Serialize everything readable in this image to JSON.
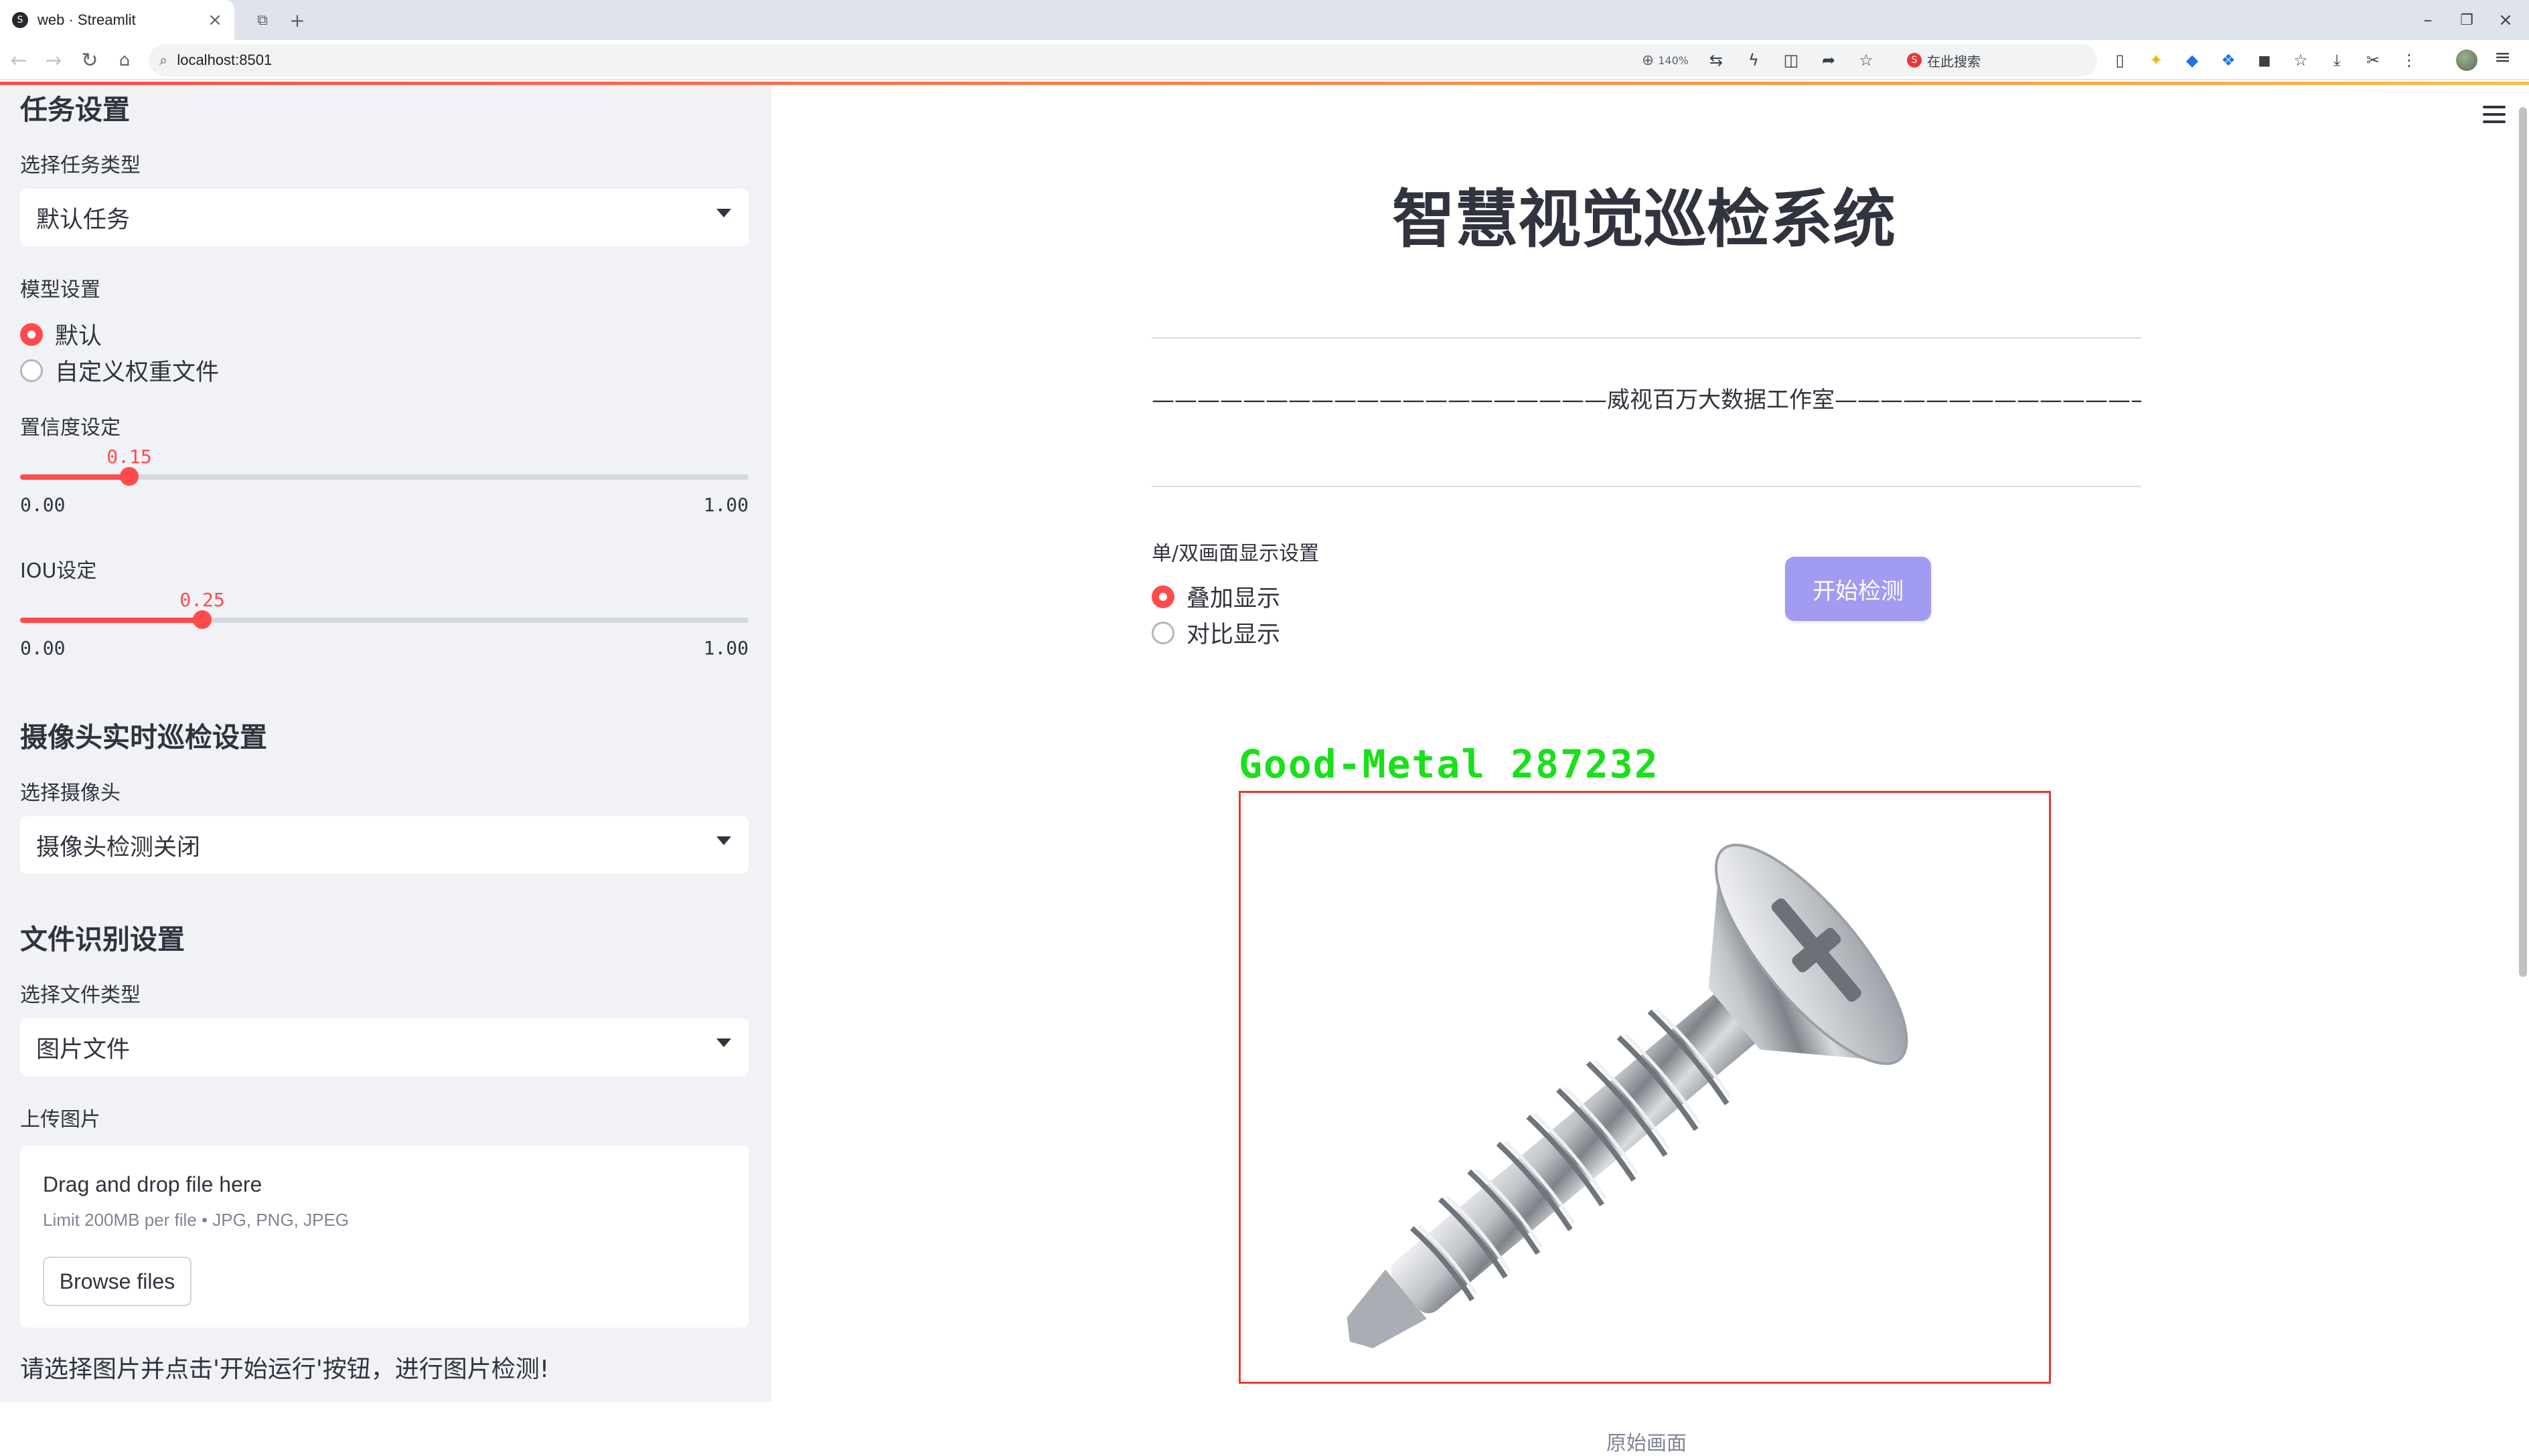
{
  "browser": {
    "tab_title": "web · Streamlit",
    "tab_favicon": "S",
    "url": "localhost:8501",
    "zoom": "140%",
    "search_engine_label": "在此搜索"
  },
  "sidebar": {
    "task_heading": "任务设置",
    "task_type_label": "选择任务类型",
    "task_type_value": "默认任务",
    "model_label": "模型设置",
    "model_options": [
      "默认",
      "自定义权重文件"
    ],
    "confidence_label": "置信度设定",
    "confidence": {
      "value": "0.15",
      "fraction": 0.15,
      "min": "0.00",
      "max": "1.00"
    },
    "iou_label": "IOU设定",
    "iou": {
      "value": "0.25",
      "fraction": 0.25,
      "min": "0.00",
      "max": "1.00"
    },
    "camera_heading": "摄像头实时巡检设置",
    "camera_label": "选择摄像头",
    "camera_value": "摄像头检测关闭",
    "file_heading": "文件识别设置",
    "file_type_label": "选择文件类型",
    "file_type_value": "图片文件",
    "upload_label": "上传图片",
    "uploader": {
      "title": "Drag and drop file here",
      "limit": "Limit 200MB per file • JPG, PNG, JPEG",
      "browse_label": "Browse files"
    },
    "hint": "请选择图片并点击'开始运行'按钮，进行图片检测!"
  },
  "main": {
    "title": "智慧视觉巡检系统",
    "studio_line": "————————————————————威视百万大数据工作室—————————————————————",
    "display_label": "单/双画面显示设置",
    "display_options": [
      "叠加显示",
      "对比显示"
    ],
    "start_button": "开始检测",
    "detection_label": "Good-Metal  287232",
    "caption": "原始画面"
  },
  "colors": {
    "accent": "#ff4b4b",
    "button": "#a29bf2",
    "detection_text": "#19e019",
    "detection_box": "#e53935"
  }
}
